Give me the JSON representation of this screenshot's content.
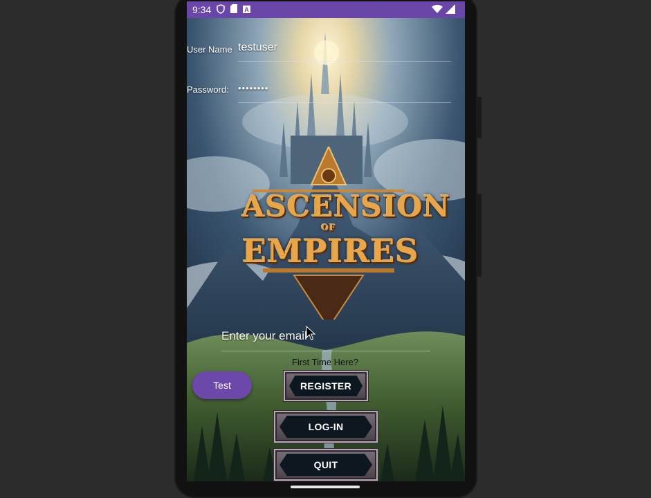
{
  "status_bar": {
    "time": "9:34",
    "left_icons": [
      "shield-icon",
      "sd-card-icon",
      "font-icon"
    ],
    "right_icons": [
      "wifi-icon",
      "signal-icon"
    ],
    "color": "#6a46a8"
  },
  "login": {
    "username_label": "User Name",
    "username_value": "testuser",
    "password_label": "Password:",
    "password_value": "••••••••"
  },
  "logo": {
    "line1": "ASCENSION",
    "line2": "OF",
    "line3": "EMPIRES"
  },
  "email": {
    "placeholder": "Enter your email"
  },
  "register_prompt": "First Time Here?",
  "buttons": {
    "test": "Test",
    "register": "REGISTER",
    "login": "LOG-IN",
    "quit": "QUIT"
  },
  "colors": {
    "accent": "#6c48ab",
    "button_frame": "#b7aab4",
    "button_fill": "#0d1720",
    "logo_gold": "#e7a64a"
  }
}
